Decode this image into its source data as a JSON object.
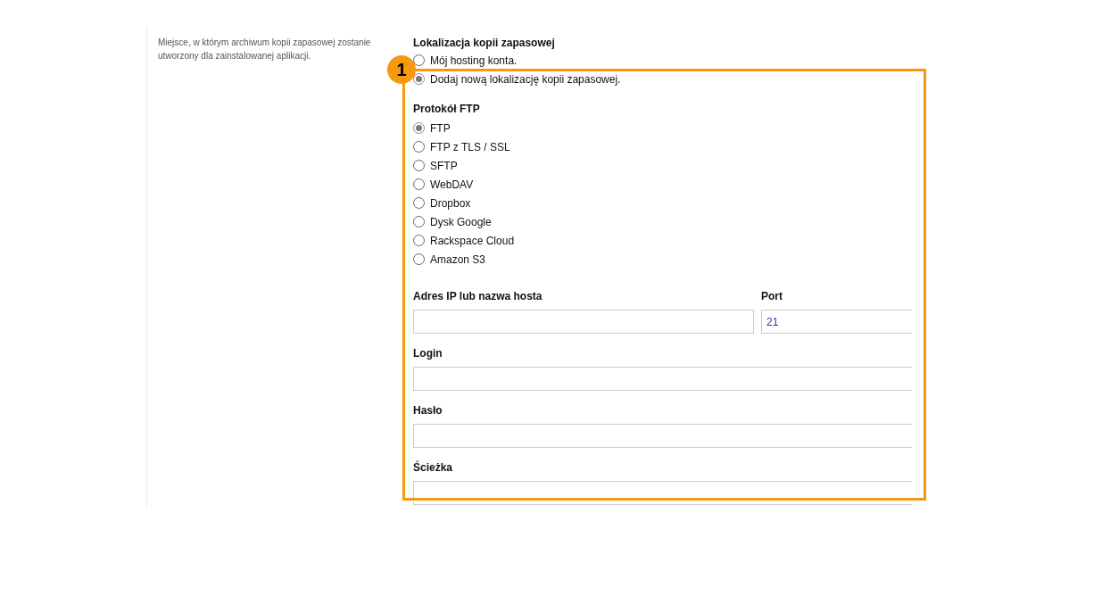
{
  "description": "Miejsce, w którym archiwum kopii zapasowej zostanie utworzony dla zainstalowanej aplikacji.",
  "location": {
    "title": "Lokalizacja kopii zapasowej",
    "options": [
      {
        "label": "Mój hosting konta.",
        "selected": false
      },
      {
        "label": "Dodaj nową lokalizację kopii zapasowej.",
        "selected": true
      }
    ]
  },
  "protocol": {
    "title": "Protokół FTP",
    "options": [
      {
        "label": "FTP",
        "selected": true
      },
      {
        "label": "FTP z TLS / SSL",
        "selected": false
      },
      {
        "label": "SFTP",
        "selected": false
      },
      {
        "label": "WebDAV",
        "selected": false
      },
      {
        "label": "Dropbox",
        "selected": false
      },
      {
        "label": "Dysk Google",
        "selected": false
      },
      {
        "label": "Rackspace Cloud",
        "selected": false
      },
      {
        "label": "Amazon S3",
        "selected": false
      }
    ]
  },
  "host": {
    "label": "Adres IP lub nazwa hosta"
  },
  "port": {
    "label": "Port",
    "value": "21"
  },
  "fields": [
    {
      "label": "Login"
    },
    {
      "label": "Hasło"
    },
    {
      "label": "Ścieżka"
    }
  ],
  "annotation": {
    "label": "1"
  }
}
